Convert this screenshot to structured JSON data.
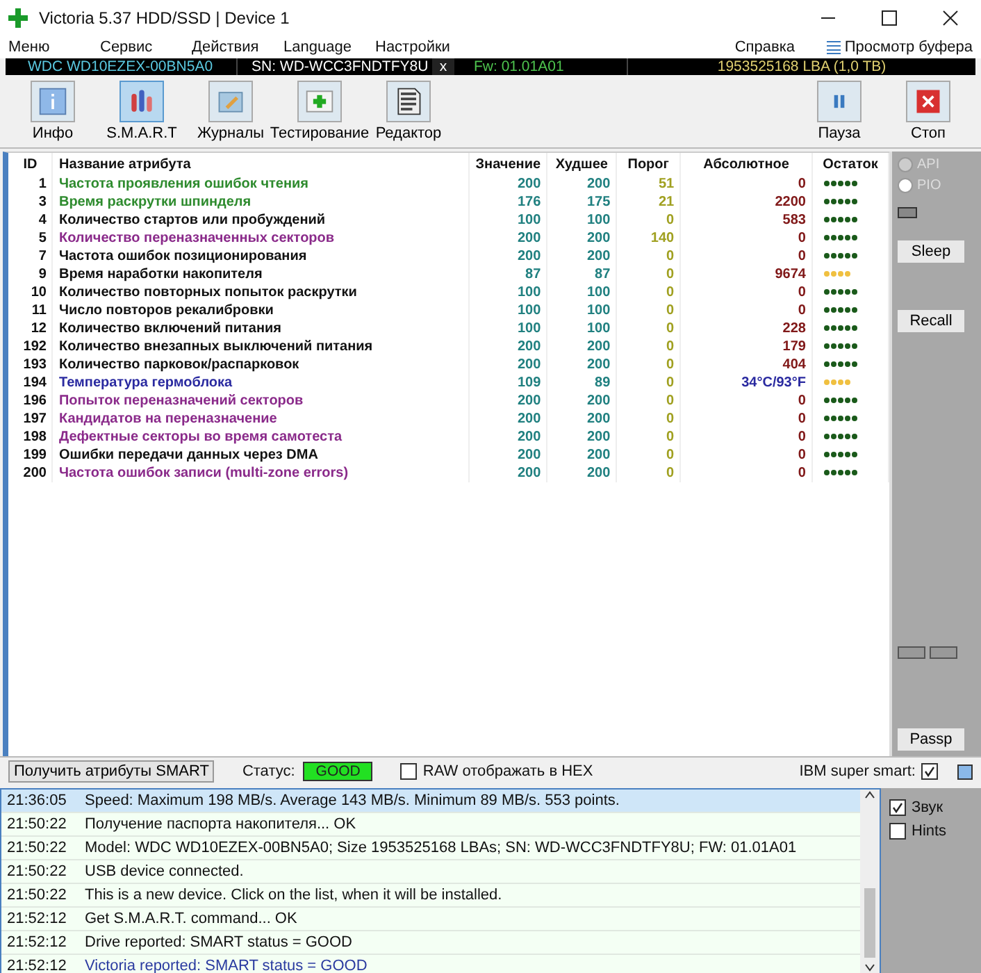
{
  "window": {
    "title": "Victoria 5.37 HDD/SSD | Device 1"
  },
  "menu": [
    "Меню",
    "Сервис",
    "Действия",
    "Language",
    "Настройки"
  ],
  "menu_right": {
    "help": "Справка",
    "buffer": "Просмотр буфера"
  },
  "device_bar": {
    "model": "WDC WD10EZEX-00BN5A0",
    "serial": "SN: WD-WCC3FNDTFY8U",
    "close": "x",
    "firmware": "Fw: 01.01A01",
    "capacity": "1953525168 LBA (1,0 TB)"
  },
  "toolbar": [
    {
      "label": "Инфо",
      "kind": "info",
      "selected": false
    },
    {
      "label": "S.M.A.R.T",
      "kind": "smart",
      "selected": true
    },
    {
      "label": "Журналы",
      "kind": "logs",
      "selected": false
    },
    {
      "label": "Тестирование",
      "kind": "test",
      "selected": false
    },
    {
      "label": "Редактор",
      "kind": "editor",
      "selected": false
    }
  ],
  "toolbar_right": [
    {
      "label": "Пауза",
      "kind": "pause"
    },
    {
      "label": "Стоп",
      "kind": "stop"
    }
  ],
  "table": {
    "columns": [
      "ID",
      "Название атрибута",
      "Значение",
      "Худшее",
      "Порог",
      "Абсолютное",
      "Остаток"
    ],
    "rows": [
      {
        "id": "1",
        "name": "Частота проявления ошибок чтения",
        "color": "#2e8b2e",
        "value": "200",
        "worst": "200",
        "threshold": "51",
        "raw": "0",
        "stars": 5
      },
      {
        "id": "3",
        "name": "Время раскрутки шпинделя",
        "color": "#2e8b2e",
        "value": "176",
        "worst": "175",
        "threshold": "21",
        "raw": "2200",
        "stars": 5
      },
      {
        "id": "4",
        "name": "Количество стартов или пробуждений",
        "color": "#111111",
        "value": "100",
        "worst": "100",
        "threshold": "0",
        "raw": "583",
        "stars": 5
      },
      {
        "id": "5",
        "name": "Количество переназначенных секторов",
        "color": "#8a2a8a",
        "value": "200",
        "worst": "200",
        "threshold": "140",
        "raw": "0",
        "stars": 5
      },
      {
        "id": "7",
        "name": "Частота ошибок позиционирования",
        "color": "#111111",
        "value": "200",
        "worst": "200",
        "threshold": "0",
        "raw": "0",
        "stars": 5
      },
      {
        "id": "9",
        "name": "Время наработки накопителя",
        "color": "#111111",
        "value": "87",
        "worst": "87",
        "threshold": "0",
        "raw": "9674",
        "stars": 4
      },
      {
        "id": "10",
        "name": "Количество повторных попыток раскрутки",
        "color": "#111111",
        "value": "100",
        "worst": "100",
        "threshold": "0",
        "raw": "0",
        "stars": 5
      },
      {
        "id": "11",
        "name": "Число повторов рекалибровки",
        "color": "#111111",
        "value": "100",
        "worst": "100",
        "threshold": "0",
        "raw": "0",
        "stars": 5
      },
      {
        "id": "12",
        "name": "Количество включений питания",
        "color": "#111111",
        "value": "100",
        "worst": "100",
        "threshold": "0",
        "raw": "228",
        "stars": 5
      },
      {
        "id": "192",
        "name": "Количество внезапных выключений питания",
        "color": "#111111",
        "value": "200",
        "worst": "200",
        "threshold": "0",
        "raw": "179",
        "stars": 5
      },
      {
        "id": "193",
        "name": "Количество парковок/распарковок",
        "color": "#111111",
        "value": "200",
        "worst": "200",
        "threshold": "0",
        "raw": "404",
        "stars": 5
      },
      {
        "id": "194",
        "name": "Температура гермоблока",
        "color": "#2a2aa0",
        "value": "109",
        "worst": "89",
        "threshold": "0",
        "raw": "34°C/93°F",
        "stars": 4
      },
      {
        "id": "196",
        "name": "Попыток переназначений секторов",
        "color": "#8a2a8a",
        "value": "200",
        "worst": "200",
        "threshold": "0",
        "raw": "0",
        "stars": 5
      },
      {
        "id": "197",
        "name": "Кандидатов на переназначение",
        "color": "#8a2a8a",
        "value": "200",
        "worst": "200",
        "threshold": "0",
        "raw": "0",
        "stars": 5
      },
      {
        "id": "198",
        "name": "Дефектные секторы во время самотеста",
        "color": "#8a2a8a",
        "value": "200",
        "worst": "200",
        "threshold": "0",
        "raw": "0",
        "stars": 5
      },
      {
        "id": "199",
        "name": "Ошибки передачи данных через DMA",
        "color": "#111111",
        "value": "200",
        "worst": "200",
        "threshold": "0",
        "raw": "0",
        "stars": 5
      },
      {
        "id": "200",
        "name": "Частота ошибок записи (multi-zone errors)",
        "color": "#8a2a8a",
        "value": "200",
        "worst": "200",
        "threshold": "0",
        "raw": "0",
        "stars": 5
      }
    ]
  },
  "side_panel": {
    "radios": [
      {
        "label": "API",
        "selected": true
      },
      {
        "label": "PIO",
        "selected": false
      }
    ],
    "buttons": [
      "Sleep",
      "Recall"
    ],
    "bottom_button": "Passp"
  },
  "status_bar": {
    "get_button": "Получить атрибуты SMART",
    "status_label": "Статус:",
    "status": "GOOD",
    "raw_hex": {
      "label": "RAW отображать в HEX",
      "checked": false
    },
    "ibm": {
      "label": "IBM super smart:",
      "checked": true
    }
  },
  "log": [
    {
      "time": "21:36:05",
      "text": "Speed: Maximum 198 MB/s. Average 143 MB/s. Minimum 89 MB/s. 553 points.",
      "kind": "normal",
      "selected": true
    },
    {
      "time": "21:50:22",
      "text": "Получение паспорта накопителя... OK",
      "kind": "normal",
      "selected": false
    },
    {
      "time": "21:50:22",
      "text": "Model: WDC WD10EZEX-00BN5A0; Size 1953525168 LBAs; SN: WD-WCC3FNDTFY8U; FW: 01.01A01",
      "kind": "normal",
      "selected": false
    },
    {
      "time": "21:50:22",
      "text": "USB device connected.",
      "kind": "normal",
      "selected": false
    },
    {
      "time": "21:50:22",
      "text": "This is a new device. Click on the list, when it will be installed.",
      "kind": "normal",
      "selected": false
    },
    {
      "time": "21:52:12",
      "text": "Get S.M.A.R.T. command... OK",
      "kind": "normal",
      "selected": false
    },
    {
      "time": "21:52:12",
      "text": "Drive reported: SMART status = GOOD",
      "kind": "normal",
      "selected": false
    },
    {
      "time": "21:52:12",
      "text": "Victoria reported: SMART status = GOOD",
      "kind": "report",
      "selected": false
    }
  ],
  "log_options": [
    {
      "label": "Звук",
      "checked": true
    },
    {
      "label": "Hints",
      "checked": false
    }
  ]
}
